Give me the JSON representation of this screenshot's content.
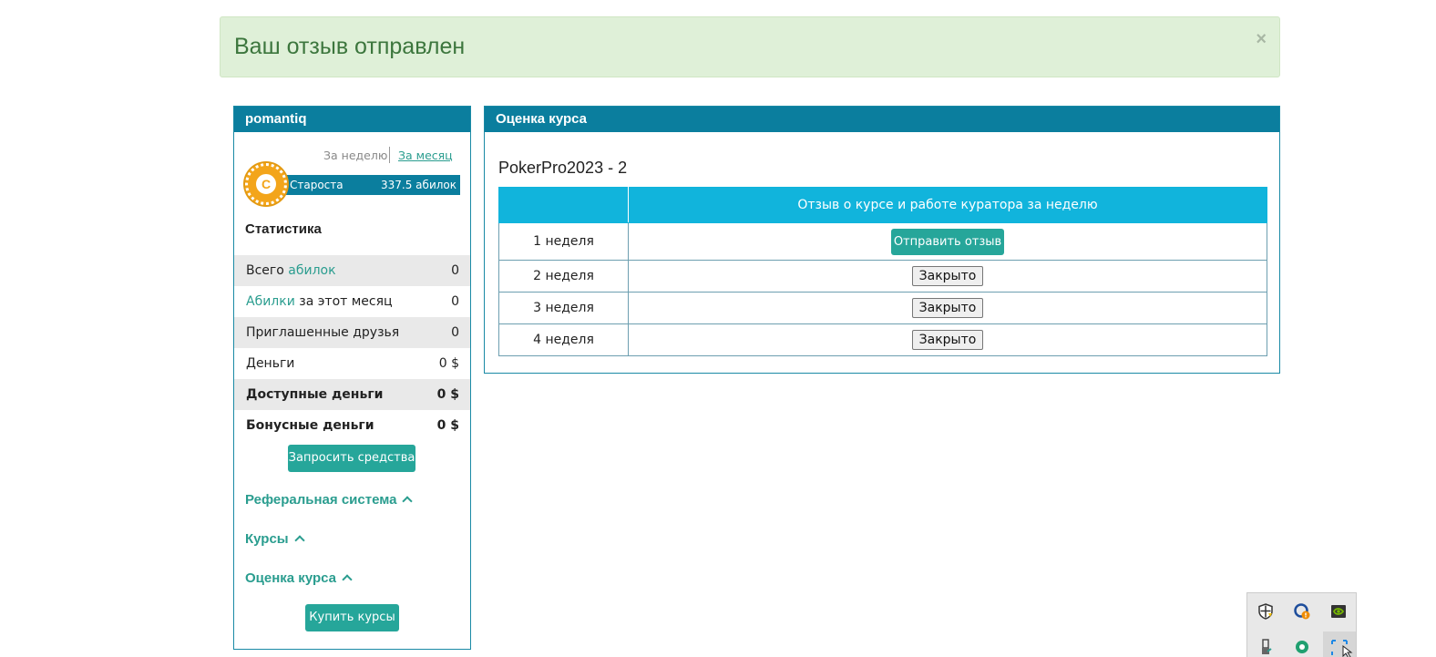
{
  "alert": {
    "message": "Ваш отзыв отправлен",
    "close": "×"
  },
  "sidebar": {
    "username": "pomantiq",
    "period": {
      "week": "За неделю",
      "month": "За месяц"
    },
    "rank": {
      "chip_letter": "C",
      "name": "Староста",
      "value": "337.5 абилок"
    },
    "stats_title": "Статистика",
    "stats": [
      {
        "label_prefix": "Всего ",
        "label_accent": "абилок",
        "label_suffix": "",
        "value": "0"
      },
      {
        "label_prefix": "",
        "label_accent": "Абилки",
        "label_suffix": " за этот месяц",
        "value": "0"
      },
      {
        "label_prefix": "Приглашенные друзья",
        "label_accent": "",
        "label_suffix": "",
        "value": "0"
      },
      {
        "label_prefix": "Деньги",
        "label_accent": "",
        "label_suffix": "",
        "value": "0 $"
      },
      {
        "label_prefix": "Доступные деньги",
        "label_accent": "",
        "label_suffix": "",
        "value": "0 $"
      },
      {
        "label_prefix": "Бонусные деньги",
        "label_accent": "",
        "label_suffix": "",
        "value": "0 $"
      }
    ],
    "request_funds": "Запросить средства",
    "links": {
      "referral": "Реферальная система",
      "courses": "Курсы",
      "rating": "Оценка курса"
    },
    "buy_courses": "Купить курсы"
  },
  "main": {
    "header": "Оценка курса",
    "course_title": "PokerPro2023 - 2",
    "table": {
      "col_week": "",
      "col_feedback": "Отзыв о курсе и работе куратора за неделю",
      "rows": [
        {
          "week": "1 неделя",
          "action": "Отправить отзыв",
          "state": "open"
        },
        {
          "week": "2 неделя",
          "action": "Закрыто",
          "state": "closed"
        },
        {
          "week": "3 неделя",
          "action": "Закрыто",
          "state": "closed"
        },
        {
          "week": "4 неделя",
          "action": "Закрыто",
          "state": "closed"
        }
      ]
    }
  },
  "colors": {
    "header": "#0b7e9e",
    "table_header": "#11b4dc",
    "accent": "#2a9d8f",
    "button": "#26a69a",
    "alert_bg": "#dff0d8",
    "alert_text": "#3c763d"
  },
  "tray_icons": [
    "security-shield-icon",
    "update-icon",
    "nvidia-icon",
    "usb-icon",
    "app-icon",
    "screen-capture-icon"
  ]
}
